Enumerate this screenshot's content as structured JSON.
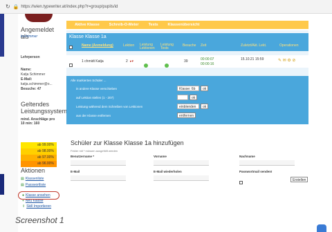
{
  "url": "https://wien.typewriter.at/index.php?r=group/pupils/id",
  "sidebar": {
    "logged_in_heading": "Angemeldet als",
    "username": "kschimmer",
    "role": "Lehrperson",
    "profile": [
      "Name:",
      "Katja Schimmer",
      "E-Mail:",
      "katja.schimmer@o...",
      "Besuche: 47"
    ],
    "grading_heading": "Geltendes Leistungssystem:",
    "min_note": "mind. Anschläge pro 10 min: 160",
    "grades": [
      "ab 99.00%",
      "ab 98.00%",
      "ab 97.00%",
      "ab 96.00%"
    ],
    "actions_heading": "Aktionen",
    "links": [
      "Klassenliste",
      "Passwortliste",
      "Klasse ansehen",
      "Neu Klasse",
      "Skill Importieren"
    ]
  },
  "nav": [
    "Aktive Klasse",
    "Schreib-O-Meter",
    "Tests",
    "Klassenübersicht"
  ],
  "class_panel": {
    "title": "Klasse Klasse 1a",
    "headers": [
      "Name (Anmeldung)",
      "Lektion",
      "Leistung Lektionen",
      "Leistung Tests",
      "Besuche",
      "Zeit",
      "Zuletzt/Akt. Lekt.",
      "Operationen"
    ],
    "row": {
      "name": "1 chmidt Katja",
      "lesson": "2",
      "visits": "39",
      "time": [
        "00:00:07",
        "00:00:16"
      ],
      "last": "15.10.21 15:59"
    }
  },
  "bulk_actions": {
    "title": "Alle markierten Schüler ...",
    "rows": [
      {
        "label": "in andere Klasse verschieben",
        "select": "Klasse: 6b",
        "ok": "ok"
      },
      {
        "label": "auf Lektion stellen (1 - 207)",
        "ok": "ok"
      },
      {
        "label": "Leistung während dem Schreiben von Lektionen",
        "select": "einblenden",
        "ok": "ok"
      },
      {
        "label": "aus der Klasse entfernen",
        "button": "entfernen"
      }
    ]
  },
  "add_student": {
    "title": "Schüler zur Klasse Klasse 1a hinzufügen",
    "note": "Felder mit * müssen ausgefüllt werden",
    "fields": [
      "Benutzername *",
      "Vorname",
      "Nachname",
      "E-Mail",
      "E-Mail wiederholen",
      "Passwortmail senden!"
    ],
    "submit": "Erstellen"
  },
  "caption": "Screenshot 1"
}
